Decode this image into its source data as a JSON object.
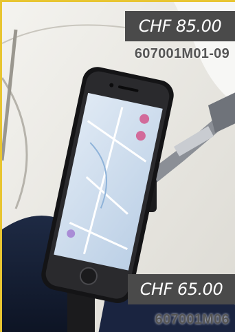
{
  "offers": [
    {
      "price": "CHF 85.00",
      "sku": "607001M01-09"
    },
    {
      "price": "CHF 65.00",
      "sku": "607001M06"
    }
  ],
  "colors": {
    "accent_border": "#e8c531",
    "price_tag_bg": "#4a4a4a",
    "sku_text": "#555555"
  }
}
